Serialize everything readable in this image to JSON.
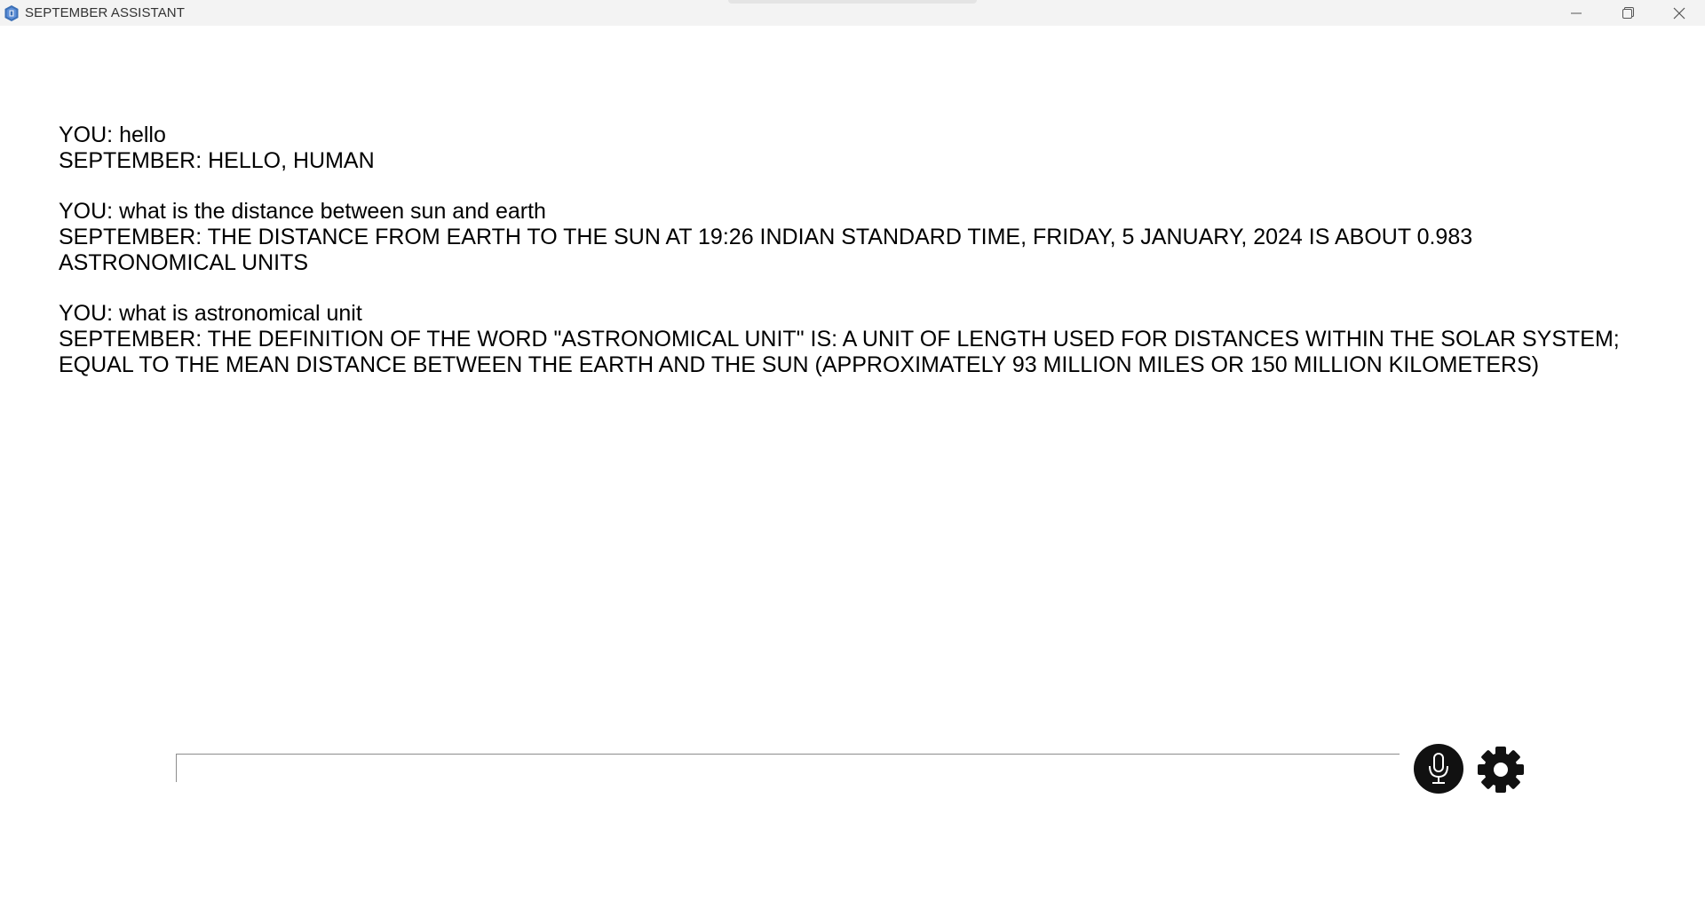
{
  "window": {
    "title": "SEPTEMBER ASSISTANT",
    "app_icon": "python-icon",
    "controls": [
      "minimize-icon",
      "restore-icon",
      "close-icon"
    ]
  },
  "chat": {
    "messages": [
      {
        "speaker": "YOU",
        "text": "YOU: hello"
      },
      {
        "speaker": "SEPTEMBER",
        "text": "SEPTEMBER: HELLO, HUMAN"
      },
      {
        "speaker": "YOU",
        "text": "YOU: what is the distance between sun and earth"
      },
      {
        "speaker": "SEPTEMBER",
        "text": "SEPTEMBER: THE DISTANCE FROM EARTH TO THE SUN AT 19:26 INDIAN STANDARD TIME, FRIDAY, 5 JANUARY, 2024 IS ABOUT 0.983 ASTRONOMICAL UNITS"
      },
      {
        "speaker": "YOU",
        "text": "YOU: what is astronomical unit"
      },
      {
        "speaker": "SEPTEMBER",
        "text": "SEPTEMBER: THE DEFINITION OF THE WORD \"ASTRONOMICAL UNIT\" IS: A UNIT OF LENGTH USED FOR DISTANCES WITHIN THE SOLAR SYSTEM; EQUAL TO THE MEAN DISTANCE BETWEEN THE EARTH AND THE SUN (APPROXIMATELY 93 MILLION MILES OR 150 MILLION KILOMETERS)"
      }
    ]
  },
  "input": {
    "value": "",
    "placeholder": ""
  },
  "buttons": {
    "mic_icon": "microphone-icon",
    "settings_icon": "gear-icon"
  },
  "colors": {
    "titlebar": "#f3f3f3",
    "button_fill": "#111111",
    "text": "#000000"
  }
}
